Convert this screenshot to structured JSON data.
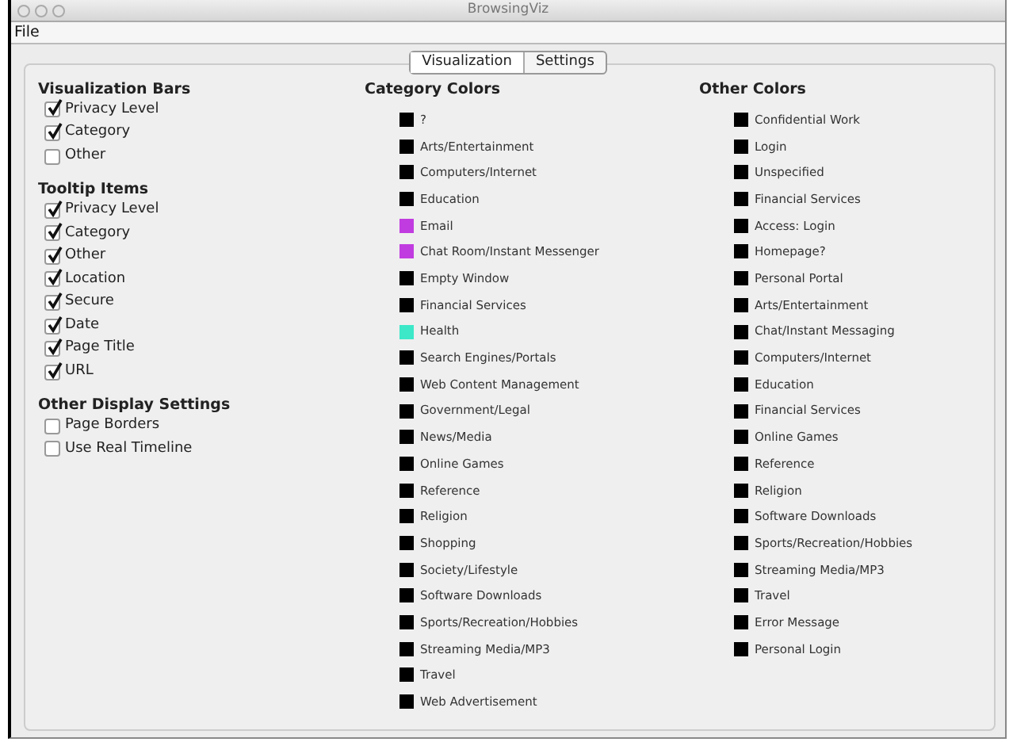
{
  "window": {
    "title": "BrowsingViz"
  },
  "menu": [
    "File"
  ],
  "tabs": [
    {
      "label": "Visualization",
      "selected": true
    },
    {
      "label": "Settings",
      "selected": false
    }
  ],
  "settings_groups": [
    {
      "title": "Visualization Bars",
      "items": [
        {
          "label": "Privacy Level",
          "checked": true
        },
        {
          "label": "Category",
          "checked": true
        },
        {
          "label": "Other",
          "checked": false
        }
      ]
    },
    {
      "title": "Tooltip Items",
      "items": [
        {
          "label": "Privacy Level",
          "checked": true
        },
        {
          "label": "Category",
          "checked": true
        },
        {
          "label": "Other",
          "checked": true
        },
        {
          "label": "Location",
          "checked": true
        },
        {
          "label": "Secure",
          "checked": true
        },
        {
          "label": "Date",
          "checked": true
        },
        {
          "label": "Page Title",
          "checked": true
        },
        {
          "label": "URL",
          "checked": true
        }
      ]
    },
    {
      "title": "Other Display Settings",
      "items": [
        {
          "label": "Page Borders",
          "checked": false
        },
        {
          "label": "Use Real Timeline",
          "checked": false
        }
      ]
    }
  ],
  "category_colors": {
    "title": "Category Colors",
    "items": [
      {
        "label": "?",
        "color": "#000000"
      },
      {
        "label": "Arts/Entertainment",
        "color": "#000000"
      },
      {
        "label": "Computers/Internet",
        "color": "#000000"
      },
      {
        "label": "Education",
        "color": "#000000"
      },
      {
        "label": "Email",
        "color": "#c13ce0"
      },
      {
        "label": "Chat Room/Instant Messenger",
        "color": "#c13ce0"
      },
      {
        "label": "Empty Window",
        "color": "#000000"
      },
      {
        "label": "Financial Services",
        "color": "#000000"
      },
      {
        "label": "Health",
        "color": "#3ce8c8"
      },
      {
        "label": "Search Engines/Portals",
        "color": "#000000"
      },
      {
        "label": "Web Content Management",
        "color": "#000000"
      },
      {
        "label": "Government/Legal",
        "color": "#000000"
      },
      {
        "label": "News/Media",
        "color": "#000000"
      },
      {
        "label": "Online Games",
        "color": "#000000"
      },
      {
        "label": "Reference",
        "color": "#000000"
      },
      {
        "label": "Religion",
        "color": "#000000"
      },
      {
        "label": "Shopping",
        "color": "#000000"
      },
      {
        "label": "Society/Lifestyle",
        "color": "#000000"
      },
      {
        "label": "Software Downloads",
        "color": "#000000"
      },
      {
        "label": "Sports/Recreation/Hobbies",
        "color": "#000000"
      },
      {
        "label": "Streaming Media/MP3",
        "color": "#000000"
      },
      {
        "label": "Travel",
        "color": "#000000"
      },
      {
        "label": "Web Advertisement",
        "color": "#000000"
      }
    ]
  },
  "other_colors": {
    "title": "Other Colors",
    "items": [
      {
        "label": "Confidential Work",
        "color": "#000000"
      },
      {
        "label": "Login",
        "color": "#000000"
      },
      {
        "label": "Unspecified",
        "color": "#000000"
      },
      {
        "label": "Financial Services",
        "color": "#000000"
      },
      {
        "label": "Access: Login",
        "color": "#000000"
      },
      {
        "label": "Homepage?",
        "color": "#000000"
      },
      {
        "label": "Personal Portal",
        "color": "#000000"
      },
      {
        "label": "Arts/Entertainment",
        "color": "#000000"
      },
      {
        "label": "Chat/Instant Messaging",
        "color": "#000000"
      },
      {
        "label": "Computers/Internet",
        "color": "#000000"
      },
      {
        "label": "Education",
        "color": "#000000"
      },
      {
        "label": "Financial Services",
        "color": "#000000"
      },
      {
        "label": "Online Games",
        "color": "#000000"
      },
      {
        "label": "Reference",
        "color": "#000000"
      },
      {
        "label": "Religion",
        "color": "#000000"
      },
      {
        "label": "Software Downloads",
        "color": "#000000"
      },
      {
        "label": "Sports/Recreation/Hobbies",
        "color": "#000000"
      },
      {
        "label": "Streaming Media/MP3",
        "color": "#000000"
      },
      {
        "label": "Travel",
        "color": "#000000"
      },
      {
        "label": "Error Message",
        "color": "#000000"
      },
      {
        "label": "Personal Login",
        "color": "#000000"
      }
    ]
  }
}
